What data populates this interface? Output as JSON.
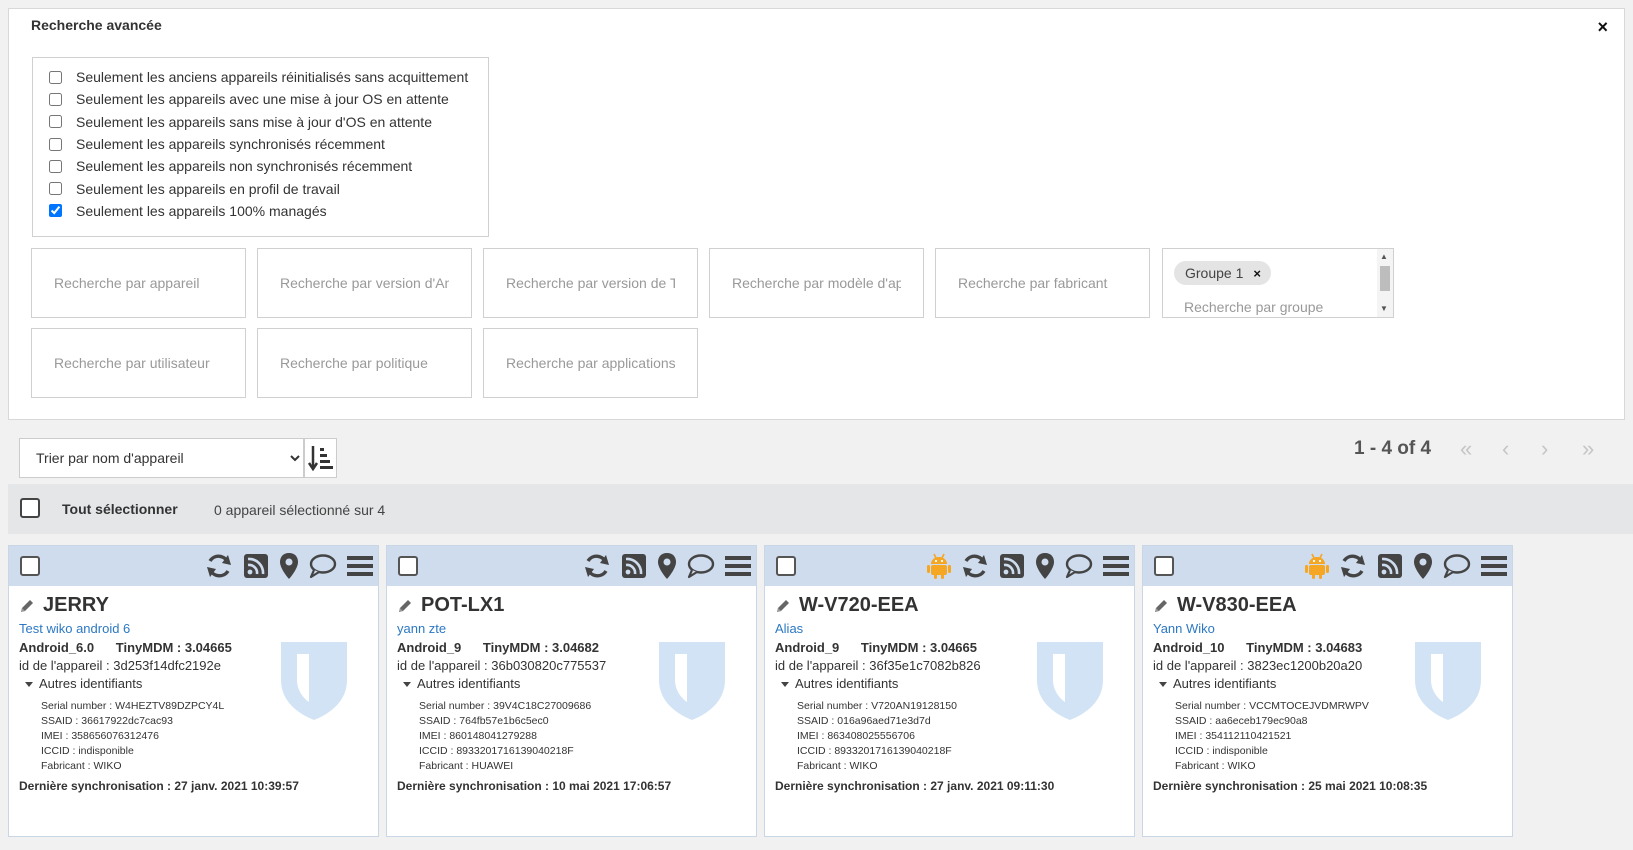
{
  "advanced_search": {
    "title": "Recherche avancée",
    "close_label": "×",
    "checkboxes": [
      {
        "label": "Seulement les anciens appareils réinitialisés sans acquittement",
        "checked": false
      },
      {
        "label": "Seulement les appareils avec une mise à jour OS en attente",
        "checked": false
      },
      {
        "label": "Seulement les appareils sans mise à jour d'OS en attente",
        "checked": false
      },
      {
        "label": "Seulement les appareils synchronisés récemment",
        "checked": false
      },
      {
        "label": "Seulement les appareils non synchronisés récemment",
        "checked": false
      },
      {
        "label": "Seulement les appareils en profil de travail",
        "checked": false
      },
      {
        "label": "Seulement les appareils 100% managés",
        "checked": true
      }
    ],
    "fields": {
      "device": "Recherche par appareil",
      "android_version": "Recherche par version d'Android",
      "tinymdm_version": "Recherche par version de TinyMDM",
      "model": "Recherche par modèle d'appareil",
      "manufacturer": "Recherche par fabricant",
      "user": "Recherche par utilisateur",
      "policy": "Recherche par politique",
      "applications": "Recherche par applications",
      "group_placeholder": "Recherche par groupe"
    },
    "group_chip": {
      "label": "Groupe 1",
      "remove": "×"
    }
  },
  "toolbar": {
    "sort_selected": "Trier par nom d'appareil",
    "pagination": "1 - 4 of 4",
    "pager": {
      "first": "«",
      "prev": "‹",
      "next": "›",
      "last": "»"
    }
  },
  "selection": {
    "select_all_label": "Tout sélectionner",
    "count_text": "0 appareil sélectionné sur 4"
  },
  "colors": {
    "header_blue": "#cedcee",
    "link_blue": "#2c78c3",
    "android_orange": "#f5a623",
    "shield": "#d2e3f5"
  },
  "devices": [
    {
      "name": "JERRY",
      "alias": "Test wiko android 6",
      "android": "Android_6.0",
      "tinymdm": "TinyMDM : 3.04665",
      "device_id": "id de l'appareil : 3d253f14dfc2192e",
      "other_ids_label": "Autres identifiants",
      "serial": "Serial number : W4HEZTV89DZPCY4L",
      "ssaid": "SSAID : 36617922dc7cac93",
      "imei": "IMEI : 358656076312476",
      "iccid": "ICCID : indisponible",
      "manufacturer": "Fabricant : WIKO",
      "last_sync": "Dernière synchronisation : 27 janv. 2021 10:39:57",
      "android_icon": false
    },
    {
      "name": "POT-LX1",
      "alias": "yann zte",
      "android": "Android_9",
      "tinymdm": "TinyMDM : 3.04682",
      "device_id": "id de l'appareil : 36b030820c775537",
      "other_ids_label": "Autres identifiants",
      "serial": "Serial number : 39V4C18C27009686",
      "ssaid": "SSAID : 764fb57e1b6c5ec0",
      "imei": "IMEI : 860148041279288",
      "iccid": "ICCID : 8933201716139040218F",
      "manufacturer": "Fabricant : HUAWEI",
      "last_sync": "Dernière synchronisation : 10 mai 2021 17:06:57",
      "android_icon": false
    },
    {
      "name": "W-V720-EEA",
      "alias": "Alias",
      "android": "Android_9",
      "tinymdm": "TinyMDM : 3.04665",
      "device_id": "id de l'appareil : 36f35e1c7082b826",
      "other_ids_label": "Autres identifiants",
      "serial": "Serial number : V720AN19128150",
      "ssaid": "SSAID : 016a96aed71e3d7d",
      "imei": "IMEI : 863408025556706",
      "iccid": "ICCID : 8933201716139040218F",
      "manufacturer": "Fabricant : WIKO",
      "last_sync": "Dernière synchronisation : 27 janv. 2021 09:11:30",
      "android_icon": true
    },
    {
      "name": "W-V830-EEA",
      "alias": "Yann Wiko",
      "android": "Android_10",
      "tinymdm": "TinyMDM : 3.04683",
      "device_id": "id de l'appareil : 3823ec1200b20a20",
      "other_ids_label": "Autres identifiants",
      "serial": "Serial number : VCCMTOCEJVDMRWPV",
      "ssaid": "SSAID : aa6eceb179ec90a8",
      "imei": "IMEI : 354112110421521",
      "iccid": "ICCID : indisponible",
      "manufacturer": "Fabricant : WIKO",
      "last_sync": "Dernière synchronisation : 25 mai 2021 10:08:35",
      "android_icon": true
    }
  ]
}
